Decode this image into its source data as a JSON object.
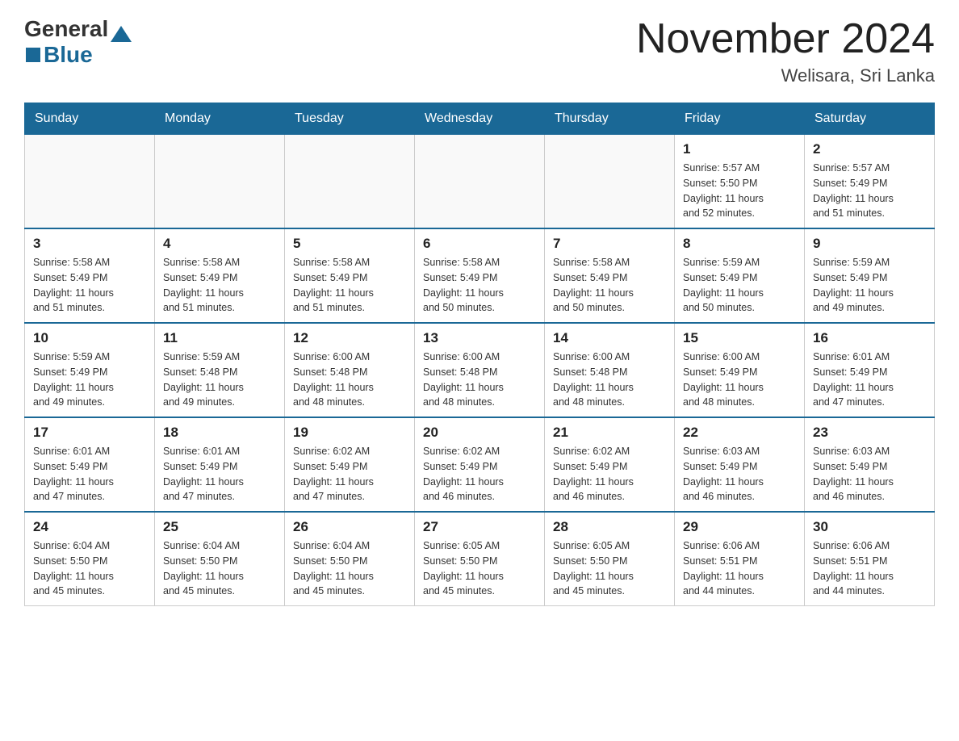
{
  "header": {
    "logo_general": "General",
    "logo_blue": "Blue",
    "month": "November 2024",
    "location": "Welisara, Sri Lanka"
  },
  "weekdays": [
    "Sunday",
    "Monday",
    "Tuesday",
    "Wednesday",
    "Thursday",
    "Friday",
    "Saturday"
  ],
  "weeks": [
    [
      {
        "day": "",
        "info": ""
      },
      {
        "day": "",
        "info": ""
      },
      {
        "day": "",
        "info": ""
      },
      {
        "day": "",
        "info": ""
      },
      {
        "day": "",
        "info": ""
      },
      {
        "day": "1",
        "info": "Sunrise: 5:57 AM\nSunset: 5:50 PM\nDaylight: 11 hours\nand 52 minutes."
      },
      {
        "day": "2",
        "info": "Sunrise: 5:57 AM\nSunset: 5:49 PM\nDaylight: 11 hours\nand 51 minutes."
      }
    ],
    [
      {
        "day": "3",
        "info": "Sunrise: 5:58 AM\nSunset: 5:49 PM\nDaylight: 11 hours\nand 51 minutes."
      },
      {
        "day": "4",
        "info": "Sunrise: 5:58 AM\nSunset: 5:49 PM\nDaylight: 11 hours\nand 51 minutes."
      },
      {
        "day": "5",
        "info": "Sunrise: 5:58 AM\nSunset: 5:49 PM\nDaylight: 11 hours\nand 51 minutes."
      },
      {
        "day": "6",
        "info": "Sunrise: 5:58 AM\nSunset: 5:49 PM\nDaylight: 11 hours\nand 50 minutes."
      },
      {
        "day": "7",
        "info": "Sunrise: 5:58 AM\nSunset: 5:49 PM\nDaylight: 11 hours\nand 50 minutes."
      },
      {
        "day": "8",
        "info": "Sunrise: 5:59 AM\nSunset: 5:49 PM\nDaylight: 11 hours\nand 50 minutes."
      },
      {
        "day": "9",
        "info": "Sunrise: 5:59 AM\nSunset: 5:49 PM\nDaylight: 11 hours\nand 49 minutes."
      }
    ],
    [
      {
        "day": "10",
        "info": "Sunrise: 5:59 AM\nSunset: 5:49 PM\nDaylight: 11 hours\nand 49 minutes."
      },
      {
        "day": "11",
        "info": "Sunrise: 5:59 AM\nSunset: 5:48 PM\nDaylight: 11 hours\nand 49 minutes."
      },
      {
        "day": "12",
        "info": "Sunrise: 6:00 AM\nSunset: 5:48 PM\nDaylight: 11 hours\nand 48 minutes."
      },
      {
        "day": "13",
        "info": "Sunrise: 6:00 AM\nSunset: 5:48 PM\nDaylight: 11 hours\nand 48 minutes."
      },
      {
        "day": "14",
        "info": "Sunrise: 6:00 AM\nSunset: 5:48 PM\nDaylight: 11 hours\nand 48 minutes."
      },
      {
        "day": "15",
        "info": "Sunrise: 6:00 AM\nSunset: 5:49 PM\nDaylight: 11 hours\nand 48 minutes."
      },
      {
        "day": "16",
        "info": "Sunrise: 6:01 AM\nSunset: 5:49 PM\nDaylight: 11 hours\nand 47 minutes."
      }
    ],
    [
      {
        "day": "17",
        "info": "Sunrise: 6:01 AM\nSunset: 5:49 PM\nDaylight: 11 hours\nand 47 minutes."
      },
      {
        "day": "18",
        "info": "Sunrise: 6:01 AM\nSunset: 5:49 PM\nDaylight: 11 hours\nand 47 minutes."
      },
      {
        "day": "19",
        "info": "Sunrise: 6:02 AM\nSunset: 5:49 PM\nDaylight: 11 hours\nand 47 minutes."
      },
      {
        "day": "20",
        "info": "Sunrise: 6:02 AM\nSunset: 5:49 PM\nDaylight: 11 hours\nand 46 minutes."
      },
      {
        "day": "21",
        "info": "Sunrise: 6:02 AM\nSunset: 5:49 PM\nDaylight: 11 hours\nand 46 minutes."
      },
      {
        "day": "22",
        "info": "Sunrise: 6:03 AM\nSunset: 5:49 PM\nDaylight: 11 hours\nand 46 minutes."
      },
      {
        "day": "23",
        "info": "Sunrise: 6:03 AM\nSunset: 5:49 PM\nDaylight: 11 hours\nand 46 minutes."
      }
    ],
    [
      {
        "day": "24",
        "info": "Sunrise: 6:04 AM\nSunset: 5:50 PM\nDaylight: 11 hours\nand 45 minutes."
      },
      {
        "day": "25",
        "info": "Sunrise: 6:04 AM\nSunset: 5:50 PM\nDaylight: 11 hours\nand 45 minutes."
      },
      {
        "day": "26",
        "info": "Sunrise: 6:04 AM\nSunset: 5:50 PM\nDaylight: 11 hours\nand 45 minutes."
      },
      {
        "day": "27",
        "info": "Sunrise: 6:05 AM\nSunset: 5:50 PM\nDaylight: 11 hours\nand 45 minutes."
      },
      {
        "day": "28",
        "info": "Sunrise: 6:05 AM\nSunset: 5:50 PM\nDaylight: 11 hours\nand 45 minutes."
      },
      {
        "day": "29",
        "info": "Sunrise: 6:06 AM\nSunset: 5:51 PM\nDaylight: 11 hours\nand 44 minutes."
      },
      {
        "day": "30",
        "info": "Sunrise: 6:06 AM\nSunset: 5:51 PM\nDaylight: 11 hours\nand 44 minutes."
      }
    ]
  ]
}
